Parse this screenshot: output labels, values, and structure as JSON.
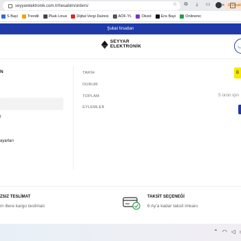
{
  "browser": {
    "url": "seyyarelektronik.com.tr/hesabim/orders/",
    "update_label": "Güncelle"
  },
  "bookmarks": [
    {
      "label": "S Bayi",
      "color": "#2d6cdf"
    },
    {
      "label": "Trendil",
      "color": "#f5a100"
    },
    {
      "label": "Plaık Linux",
      "color": "#444444"
    },
    {
      "label": "Dijital Vergi Dairesi",
      "color": "#d12c2c"
    },
    {
      "label": "AÖF-YL",
      "color": "#555555"
    },
    {
      "label": "Okxid",
      "color": "#7a35c7"
    },
    {
      "label": "Ens Bayi",
      "color": "#111111"
    },
    {
      "label": "Onlinenic",
      "color": "#21a048"
    }
  ],
  "promo": {
    "text": "Şubat fırsatları"
  },
  "logo": {
    "line1": "SEYYAR",
    "line2": "ELEKTRONİK"
  },
  "sidebar": {
    "title_fragment": "N",
    "item_fragment": "r",
    "settings_fragment": "ayarları"
  },
  "order": {
    "date_label": "TARİH",
    "status_label": "DURUM",
    "total_label": "TOPLAM",
    "actions_label": "EYLEMLER",
    "items_summary": "5 ürün için",
    "badge_fragment": "B"
  },
  "features": {
    "left_title": "ZSIZ TESLİMAT",
    "left_desc": "m illere kargo teslimatı",
    "right_title": "TAKSİT SEÇENEĞİ",
    "right_desc": "6 Ay'a kadar taksit imkanı"
  }
}
